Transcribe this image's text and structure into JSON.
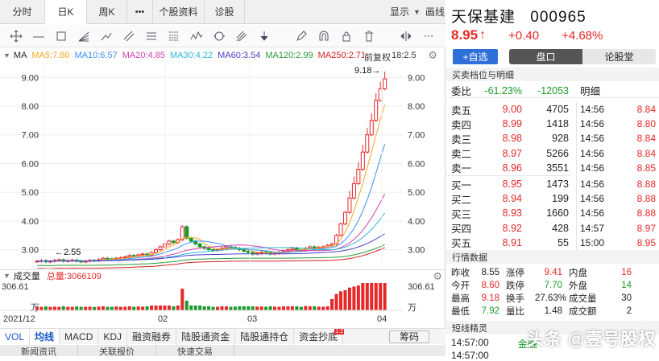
{
  "topbar": {
    "tabs": [
      "分时",
      "日K",
      "周K"
    ],
    "more": "•••",
    "f10": "个股资料",
    "diag": "诊股",
    "display": "显示",
    "draw": "画线"
  },
  "ma": {
    "label": "MA",
    "items": [
      {
        "text": "MA5:7.86",
        "color": "#f5a623"
      },
      {
        "text": "MA10:6.57",
        "color": "#3a8df0"
      },
      {
        "text": "MA20:4.85",
        "color": "#d43fb0"
      },
      {
        "text": "MA30:4.22",
        "color": "#2bb8d8"
      },
      {
        "text": "MA60:3.54",
        "color": "#4a3fc8"
      },
      {
        "text": "MA120:2.99",
        "color": "#2a9a3a"
      },
      {
        "text": "MA250:2.71",
        "color": "#d42020"
      }
    ],
    "overlay": "前复权",
    "overlay2": "18:2.5"
  },
  "price_axis": [
    "9.00",
    "8.00",
    "7.00",
    "6.00",
    "5.00",
    "4.00",
    "3.00"
  ],
  "annotations": {
    "high": "9.18→",
    "low": "←2.55"
  },
  "dates": [
    "2021/12",
    "02",
    "03",
    "04"
  ],
  "volume": {
    "label": "成交量",
    "total": "总量:3066109",
    "max": "306.61",
    "unit": "万"
  },
  "chart_data": {
    "type": "candlestick",
    "series_close_approx": [
      2.6,
      2.62,
      2.58,
      2.6,
      2.63,
      2.65,
      2.6,
      2.62,
      2.64,
      2.6,
      2.58,
      2.6,
      2.63,
      2.62,
      2.65,
      2.7,
      2.68,
      2.66,
      2.7,
      2.72,
      2.75,
      2.8,
      2.78,
      2.82,
      2.85,
      2.8,
      2.9,
      3.0,
      3.1,
      3.2,
      3.3,
      3.25,
      3.35,
      3.8,
      3.4,
      3.3,
      3.2,
      3.1,
      3.05,
      3.0,
      2.98,
      3.0,
      3.05,
      3.1,
      3.08,
      3.05,
      3.0,
      2.95,
      2.9,
      2.85,
      2.88,
      2.92,
      2.9,
      2.85,
      2.88,
      2.9,
      2.95,
      3.0,
      3.05,
      3.0,
      2.98,
      3.05,
      3.1,
      3.05,
      3.08,
      3.1,
      3.15,
      3.2,
      3.5,
      3.9,
      4.3,
      4.8,
      5.3,
      5.8,
      6.4,
      7.0,
      7.5,
      8.2,
      8.6,
      8.95
    ],
    "ylim": [
      2.4,
      9.4
    ],
    "volume_max": 306.61
  },
  "bottom_tabs": [
    "VOL",
    "均线",
    "MACD",
    "KDJ",
    "融资融券",
    "陆股通资金",
    "陆股通持仓",
    "资金抄底",
    "筹码"
  ],
  "bottom_badge": "1:2",
  "news_tabs": [
    "新闻资讯",
    "关联报价",
    "快速交易"
  ],
  "stock": {
    "name": "天保基建",
    "code": "000965",
    "price": "8.95",
    "arrow": "↑",
    "change": "+0.40",
    "change_pct": "+4.68%",
    "add_watch": "+自选",
    "seg1": "盘口",
    "seg2": "论股堂"
  },
  "orderbook": {
    "header": "买卖档位与明细",
    "wb_label": "委比",
    "wb_pct": "-61.23%",
    "wb_diff": "-12053",
    "detail_label": "明细",
    "asks": [
      {
        "label": "卖五",
        "price": "9.00",
        "vol": "4705"
      },
      {
        "label": "卖四",
        "price": "8.99",
        "vol": "1418"
      },
      {
        "label": "卖三",
        "price": "8.98",
        "vol": "928"
      },
      {
        "label": "卖二",
        "price": "8.97",
        "vol": "5266"
      },
      {
        "label": "卖一",
        "price": "8.96",
        "vol": "3551"
      }
    ],
    "bids": [
      {
        "label": "买一",
        "price": "8.95",
        "vol": "1473"
      },
      {
        "label": "买二",
        "price": "8.94",
        "vol": "199"
      },
      {
        "label": "买三",
        "price": "8.93",
        "vol": "1660"
      },
      {
        "label": "买四",
        "price": "8.92",
        "vol": "428"
      },
      {
        "label": "买五",
        "price": "8.91",
        "vol": "55"
      }
    ],
    "ticks": [
      {
        "time": "14:56",
        "price": "8.84"
      },
      {
        "time": "14:56",
        "price": "8.80"
      },
      {
        "time": "14:56",
        "price": "8.84"
      },
      {
        "time": "14:56",
        "price": "8.84"
      },
      {
        "time": "14:56",
        "price": "8.85"
      },
      {
        "time": "14:56",
        "price": "8.88"
      },
      {
        "time": "14:56",
        "price": "8.88"
      },
      {
        "time": "14:56",
        "price": "8.88"
      },
      {
        "time": "14:57",
        "price": "8.97"
      },
      {
        "time": "15:00",
        "price": "8.95"
      }
    ]
  },
  "stats": {
    "header": "行情数据",
    "rows": [
      [
        "昨收",
        "8.55",
        "涨停",
        "9.41",
        "内盘",
        "16"
      ],
      [
        "今开",
        "8.60",
        "跌停",
        "7.70",
        "外盘",
        "14"
      ],
      [
        "最高",
        "9.18",
        "换手",
        "27.63%",
        "成交量",
        "30"
      ],
      [
        "最低",
        "7.92",
        "量比",
        "1.48",
        "成交额",
        "2"
      ]
    ]
  },
  "short": {
    "header": "短线精灵",
    "time1": "14:57:00",
    "text1": "金融",
    "time2": "14:57:00"
  },
  "watermark": "头条 @壹号股权"
}
